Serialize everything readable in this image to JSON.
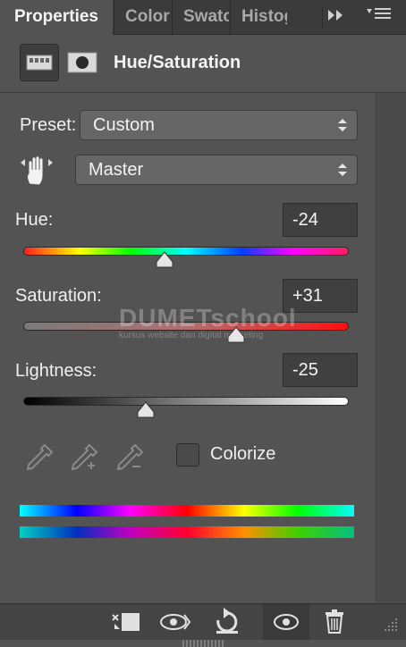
{
  "tabs": [
    {
      "label": "Properties",
      "active": true
    },
    {
      "label": "Color",
      "active": false
    },
    {
      "label": "Swatches",
      "active": false
    },
    {
      "label": "Histogram",
      "active": false
    }
  ],
  "header": {
    "title": "Hue/Saturation"
  },
  "preset": {
    "label": "Preset:",
    "value": "Custom"
  },
  "channel": {
    "value": "Master"
  },
  "sliders": [
    {
      "label": "Hue:",
      "value": "-24",
      "min": -180,
      "max": 180,
      "current": -24
    },
    {
      "label": "Saturation:",
      "value": "+31",
      "min": -100,
      "max": 100,
      "current": 31
    },
    {
      "label": "Lightness:",
      "value": "-25",
      "min": -100,
      "max": 100,
      "current": -25
    }
  ],
  "colorize": {
    "label": "Colorize",
    "checked": false
  },
  "watermark": {
    "brand": "DUMETschool",
    "tagline": "kursus website dan digital marketing"
  },
  "colors": {
    "panel_bg": "#535353",
    "tab_bg": "#3b3b3b",
    "field_bg": "#404040"
  },
  "footer_icons": [
    "clip-to-layer-icon",
    "view-previous-state-icon",
    "reset-icon",
    "visibility-eye-icon",
    "trash-icon"
  ]
}
